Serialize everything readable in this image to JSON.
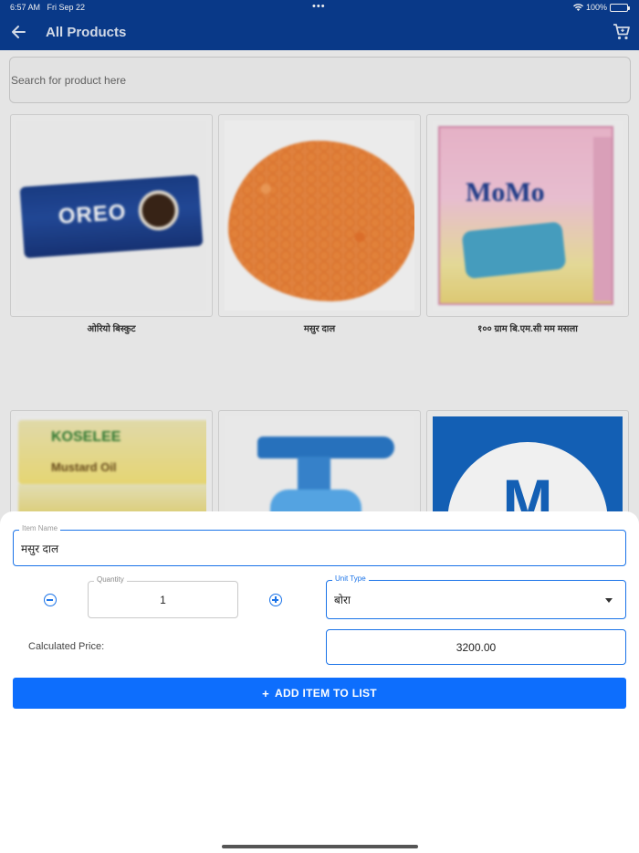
{
  "status": {
    "time": "6:57 AM",
    "date": "Fri Sep 22",
    "dots": "•••",
    "battery": "100%"
  },
  "appbar": {
    "title": "All Products"
  },
  "search": {
    "placeholder": "Search for product here"
  },
  "products": [
    {
      "name": "ओरियो बिस्कुट",
      "image": "oreo-pack"
    },
    {
      "name": "मसुर दाल",
      "image": "lentils"
    },
    {
      "name": "१०० ग्राम बि.एम.सी मम मसला",
      "image": "momo-masala-box"
    },
    {
      "name": "",
      "image": "mustard-oil-box"
    },
    {
      "name": "",
      "image": "spray-bottle"
    },
    {
      "name": "",
      "image": "m-logo"
    }
  ],
  "product_image_text": {
    "oreo": "OREO",
    "momo": "MoMo",
    "oil_brand": "KOSELEE",
    "oil_type": "Mustard Oil",
    "m_logo": "M"
  },
  "sheet": {
    "item_name_label": "Item Name",
    "item_name_value": "मसुर दाल",
    "quantity_label": "Quantity",
    "quantity_value": "1",
    "unit_type_label": "Unit Type",
    "unit_type_value": "बोरा",
    "calc_label": "Calculated Price:",
    "calc_value": "3200.00",
    "add_button_plus": "+",
    "add_button_label": "ADD ITEM TO LIST"
  },
  "colors": {
    "appbar": "#0a3d91",
    "accent": "#1a73e8",
    "button": "#0d6efd"
  }
}
